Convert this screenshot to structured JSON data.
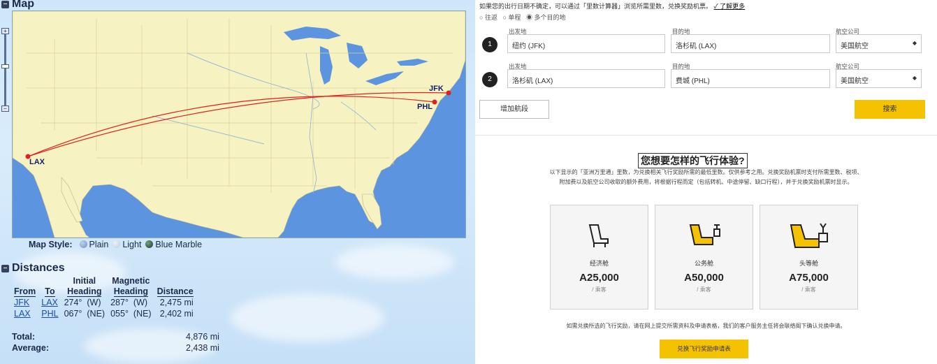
{
  "left": {
    "map_title": "Map",
    "airports": {
      "jfk": "JFK",
      "phl": "PHL",
      "lax": "LAX"
    },
    "map_style": {
      "label": "Map Style:",
      "options": [
        "Plain",
        "Light",
        "Blue Marble"
      ]
    },
    "distances": {
      "title": "Distances",
      "headers": {
        "from": "From",
        "to": "To",
        "initial_top": "Initial",
        "initial_bottom": "Heading",
        "magnetic_top": "Magnetic",
        "magnetic_bottom": "Heading",
        "distance": "Distance"
      },
      "rows": [
        {
          "from": "JFK",
          "to": "LAX",
          "initial": "274°",
          "initial_dir": "(W)",
          "magnetic": "287°",
          "magnetic_dir": "(W)",
          "distance": "2,475 mi"
        },
        {
          "from": "LAX",
          "to": "PHL",
          "initial": "067°",
          "initial_dir": "(NE)",
          "magnetic": "055°",
          "magnetic_dir": "(NE)",
          "distance": "2,402 mi"
        }
      ],
      "total_label": "Total:",
      "total_value": "4,876 mi",
      "average_label": "Average:",
      "average_value": "2,438 mi"
    }
  },
  "right": {
    "notice": "如果您的出行日期不确定，可以通过「里数计算器」浏览所需里数，兑换奖励机票。",
    "notice_link": "✓ 了解更多",
    "trip_types": [
      "往返",
      "单程",
      "多个目的地"
    ],
    "labels": {
      "origin": "出发地",
      "destination": "目的地",
      "cabin": "航空公司"
    },
    "segments": [
      {
        "num": "1",
        "origin": "纽约 (JFK)",
        "destination": "洛杉矶 (LAX)",
        "airline": "美国航空"
      },
      {
        "num": "2",
        "origin": "洛杉矶 (LAX)",
        "destination": "费城 (PHL)",
        "airline": "美国航空"
      }
    ],
    "add_segment": "增加航段",
    "search": "搜索",
    "experience_title": "您想要怎样的飞行体验?",
    "experience_desc_1": "以下显示的「亚洲万里通」里数，为兑换相关飞行奖励所需的最低里数。仅供参考之用。兑换奖励机票时支付所需里数、税项、",
    "experience_desc_2": "附加费以及航空公司收取的额外费用，将根据行程而定（包括转机、中途停留、缺口行程），并于兑换奖励机票时显示。",
    "cabins": [
      {
        "name": "经济舱",
        "price": "A25,000",
        "per": "/ 乘客"
      },
      {
        "name": "公务舱",
        "price": "A50,000",
        "per": "/ 乘客"
      },
      {
        "name": "头等舱",
        "price": "A75,000",
        "per": "/ 乘客"
      }
    ],
    "footer_text": "如需兑换所选的飞行奖励，请在网上提交所需资料及申请表格，我们的客户服务主任将会联络阁下确认兑换申请。",
    "footer_button": "兑换飞行奖励申请表"
  },
  "colors": {
    "accent_yellow": "#f4c200",
    "route_red": "#e02020",
    "land": "#f6f2c2",
    "water": "#5d94df"
  }
}
